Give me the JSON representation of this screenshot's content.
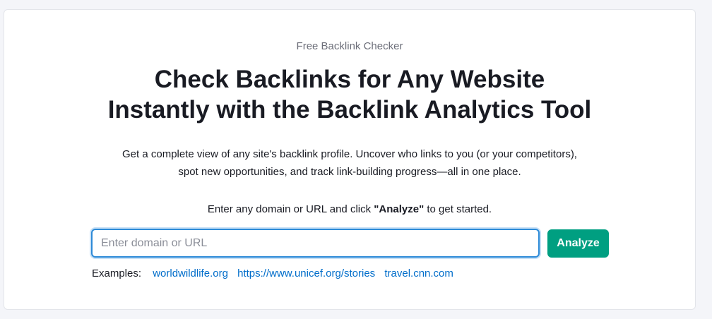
{
  "hero": {
    "eyebrow": "Free Backlink Checker",
    "title_line1": "Check Backlinks for Any Website",
    "title_line2": "Instantly with the Backlink Analytics Tool",
    "desc_line1": "Get a complete view of any site's backlink profile. Uncover who links to you (or your competitors),",
    "desc_line2": "spot new opportunities, and track link-building progress—all in one place."
  },
  "instruction": {
    "prefix": "Enter any domain or URL and click ",
    "action": "\"Analyze\"",
    "suffix": " to get started."
  },
  "search": {
    "value": "",
    "placeholder": "Enter domain or URL",
    "button_label": "Analyze"
  },
  "examples": {
    "label": "Examples:",
    "links": [
      "worldwildlife.org",
      "https://www.unicef.org/stories",
      "travel.cnn.com"
    ]
  },
  "colors": {
    "accent": "#009f81",
    "link": "#006dca",
    "focus_border": "#2e8bd8",
    "text": "#191b23",
    "muted": "#6c6e79"
  }
}
